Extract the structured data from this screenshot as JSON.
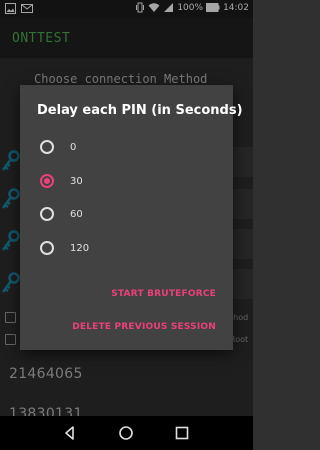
{
  "status_bar": {
    "battery_percent": "100%",
    "time": "14:02"
  },
  "app": {
    "title": "ONTTEST"
  },
  "background": {
    "heading": "Choose connection Method",
    "side_text_1": "thod",
    "side_text_2": "Root",
    "pin_1": "21464065",
    "pin_2": "13830131"
  },
  "dialog": {
    "title": "Delay each PIN (in Seconds)",
    "options": [
      {
        "label": "0",
        "selected": false
      },
      {
        "label": "30",
        "selected": true
      },
      {
        "label": "60",
        "selected": false
      },
      {
        "label": "120",
        "selected": false
      }
    ],
    "start_button": "START BRUTEFORCE",
    "delete_button": "DELETE PREVIOUS SESSION"
  },
  "colors": {
    "accent": "#ec407a",
    "app_title": "#4caf50",
    "dialog_bg": "#424242",
    "key_icon": "#1e88a8"
  },
  "icons": {
    "status_left": [
      "image-icon",
      "mail-icon"
    ],
    "status_right": [
      "vibrate-icon",
      "wifi-icon",
      "signal-icon",
      "battery-icon"
    ],
    "nav": [
      "back-icon",
      "home-icon",
      "recents-icon"
    ]
  }
}
